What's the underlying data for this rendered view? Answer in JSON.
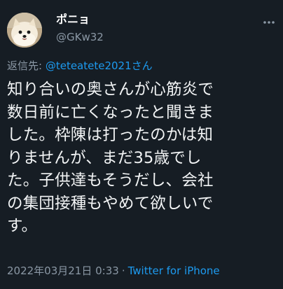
{
  "user": {
    "display_name": "ポニョ",
    "handle": "@GKw32"
  },
  "reply": {
    "prefix": "返信先: ",
    "mention": "@teteatete2021さん"
  },
  "tweet": {
    "lines": [
      "知り合いの奥さんが心筋炎で",
      "数日前に亡くなったと聞きま",
      "した。枠陳は打ったのかは知",
      "りませんが、まだ35歳でし",
      "た。子供達もそうだし、会社",
      "の集団接種もやめて欲しいで",
      "す。"
    ]
  },
  "meta": {
    "timestamp": "2022年03月21日 0:33",
    "separator": "·",
    "source": "Twitter for iPhone"
  },
  "icons": {
    "more": "more-dots-icon",
    "avatar": "pomeranian-avatar"
  },
  "colors": {
    "background": "#161d24",
    "text": "#e7e9ea",
    "secondary": "#8b98a5",
    "accent": "#1d9bf0"
  }
}
